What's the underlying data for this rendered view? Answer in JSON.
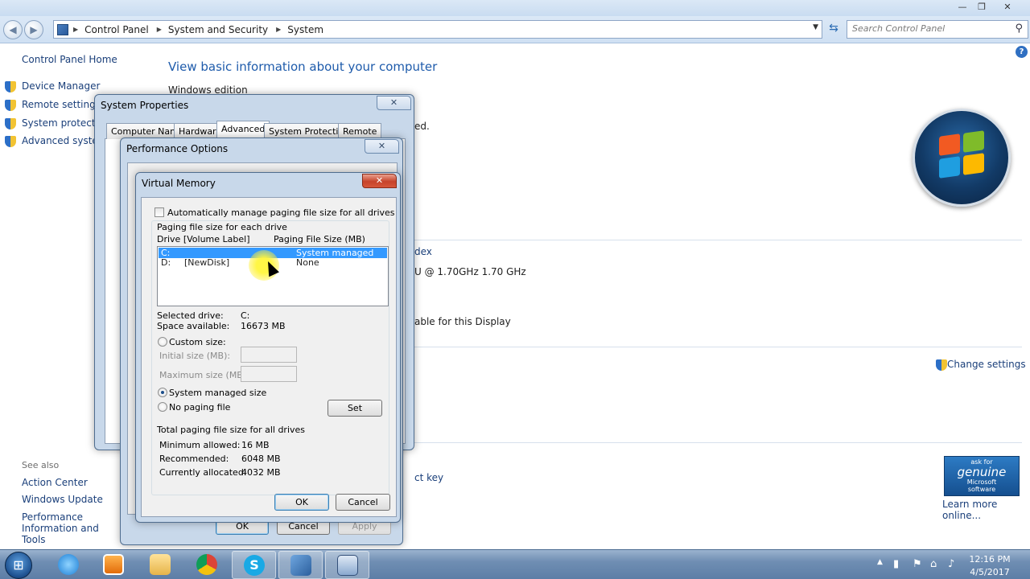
{
  "explorer": {
    "caption_buttons": {
      "minimize": "—",
      "maximize": "❐",
      "close": "✕"
    },
    "address_crumbs": [
      "Control Panel",
      "System and Security",
      "System"
    ],
    "search_placeholder": "Search Control Panel"
  },
  "left_nav": {
    "home": "Control Panel Home",
    "items": [
      "Device Manager",
      "Remote settings",
      "System protection",
      "Advanced system settings"
    ],
    "see_also_heading": "See also",
    "see_also_items": [
      "Action Center",
      "Windows Update",
      "Performance Information and Tools"
    ]
  },
  "main": {
    "title": "View basic information about your computer",
    "windows_edition": "Windows edition",
    "fragments": {
      "reserved": "ed.",
      "index": "dex",
      "processor": "U @ 1.70GHz   1.70 GHz",
      "display": "able for this Display",
      "change_settings": "Change settings",
      "product_key": "ct key"
    },
    "genuine": {
      "line1": "ask for",
      "line2": "genuine",
      "line3": "Microsoft",
      "line4": "software"
    },
    "learn_more": "Learn more online..."
  },
  "system_properties": {
    "title": "System Properties",
    "close": "✕",
    "tabs": [
      "Computer Name",
      "Hardware",
      "Advanced",
      "System Protection",
      "Remote"
    ],
    "active_tab": "Advanced"
  },
  "performance_options": {
    "title": "Performance Options",
    "close": "✕",
    "buttons": {
      "ok": "OK",
      "cancel": "Cancel",
      "apply": "Apply"
    }
  },
  "virtual_memory": {
    "title": "Virtual Memory",
    "close": "✕",
    "auto_manage_label": "Automatically manage paging file size for all drives",
    "paging_section": "Paging file size for each drive",
    "col_drive": "Drive  [Volume Label]",
    "col_size": "Paging File Size (MB)",
    "drives": [
      {
        "drive": "C:",
        "label": "",
        "size": "System managed"
      },
      {
        "drive": "D:",
        "label": "[NewDisk]",
        "size": "None"
      }
    ],
    "selected_drive_label": "Selected drive:",
    "selected_drive_value": "C:",
    "space_available_label": "Space available:",
    "space_available_value": "16673 MB",
    "custom_size": "Custom size:",
    "initial_size": "Initial size (MB):",
    "maximum_size": "Maximum size (MB):",
    "system_managed": "System managed size",
    "no_paging": "No paging file",
    "set_button": "Set",
    "totals_heading": "Total paging file size for all drives",
    "min_allowed_label": "Minimum allowed:",
    "min_allowed_value": "16 MB",
    "recommended_label": "Recommended:",
    "recommended_value": "6048 MB",
    "allocated_label": "Currently allocated:",
    "allocated_value": "4032 MB",
    "ok": "OK",
    "cancel": "Cancel"
  },
  "taskbar": {
    "time": "12:16 PM",
    "date": "4/5/2017"
  },
  "colors": {
    "link": "#1a3f7a",
    "title": "#1e5bab",
    "selection": "#3399ff"
  }
}
